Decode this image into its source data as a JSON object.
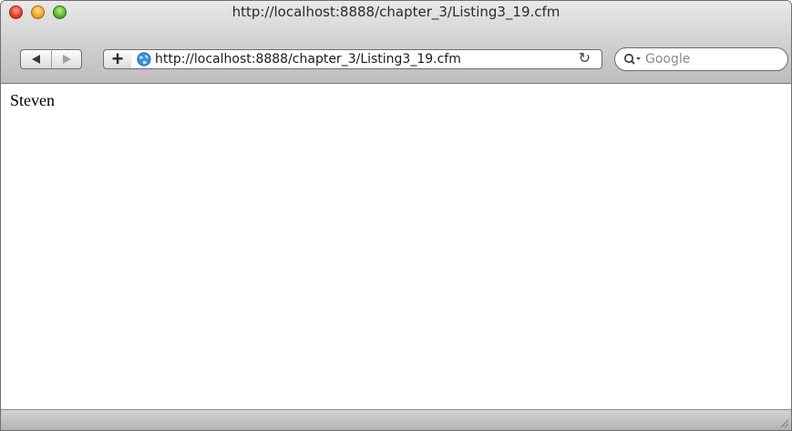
{
  "window": {
    "title": "http://localhost:8888/chapter_3/Listing3_19.cfm"
  },
  "toolbar": {
    "back_icon": "back-arrow-icon",
    "forward_icon": "forward-arrow-icon",
    "add_bookmark_label": "+",
    "url": "http://localhost:8888/chapter_3/Listing3_19.cfm",
    "reload_glyph": "↻",
    "search_placeholder": "Google"
  },
  "page": {
    "body_text": "Steven"
  },
  "colors": {
    "chrome_top": "#e9e9e9",
    "chrome_bottom": "#bdbdbd",
    "close": "#e23b26",
    "minimize": "#f0a322",
    "maximize": "#56b72c"
  }
}
